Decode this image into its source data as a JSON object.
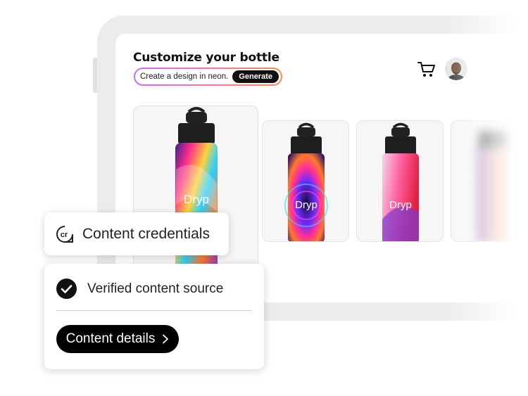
{
  "page": {
    "title": "Customize your bottle",
    "prompt": {
      "value": "Create a design in neon.",
      "generate_label": "Generate"
    },
    "header_icons": [
      "cart-icon",
      "avatar"
    ]
  },
  "products": [
    {
      "brand": "Dryp",
      "design": "rainbow-tie-dye",
      "selected": true
    },
    {
      "brand": "Dryp",
      "design": "neon-rings"
    },
    {
      "brand": "Dryp",
      "design": "pink-red-waves"
    },
    {
      "brand": "",
      "design": "blurred-partial"
    }
  ],
  "credentials": {
    "label": "Content credentials",
    "icon": "cr-icon",
    "verified_label": "Verified content source",
    "verified_icon": "checkmark-circle-icon",
    "details_label": "Content details",
    "details_icon": "chevron-right-icon"
  },
  "colors": {
    "accent_gradient": [
      "#c86bff",
      "#ff6fa3",
      "#ff8b4a"
    ],
    "button": "#000000"
  }
}
